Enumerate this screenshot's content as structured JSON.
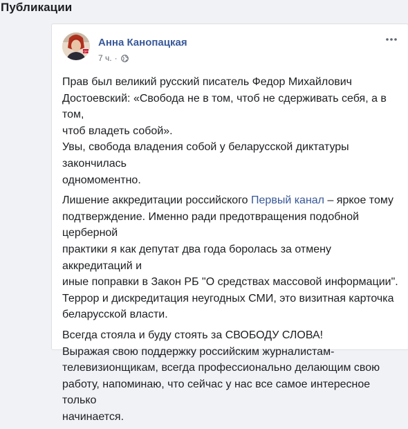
{
  "section": {
    "title": "Публикации"
  },
  "post": {
    "author": "Анна Канопацкая",
    "time": "7 ч.",
    "separator": "·",
    "more_icon": "more-horizontal-icon",
    "privacy_icon": "globe-icon",
    "paragraphs": [
      {
        "lines": [
          "Прав был великий русский писатель Федор Михайлович",
          "Достоевский: «Свобода не в том, чтоб не сдерживать себя, а в том,",
          "чтоб владеть собой».",
          "Увы, свобода владения собой у беларусской диктатуры закончилась",
          "одномоментно."
        ]
      },
      {
        "line1_before_link": "Лишение аккредитации российского ",
        "link_text": "Первый канал",
        "line1_after_link": " – яркое тому",
        "lines": [
          "подтверждение. Именно ради предотвращения подобной церберной",
          "практики я как депутат два года боролась за отмену аккредитаций и",
          "иные поправки в Закон РБ \"О средствах массовой информации\".",
          "Террор и дискредитация неугодных СМИ, это визитная карточка",
          "беларусской власти."
        ]
      },
      {
        "lines": [
          "Всегда стояла и буду стоять за СВОБОДУ СЛОВА!",
          "Выражая свою поддержку российским журналистам-",
          "телевизионщикам, всегда профессионально делающим свою",
          "работу, напоминаю, что сейчас у нас все самое интересное только",
          "начинается."
        ]
      }
    ]
  },
  "colors": {
    "link": "#385898",
    "text": "#1c1e21",
    "meta": "#616770",
    "background": "#f0f2f5",
    "card": "#ffffff"
  }
}
